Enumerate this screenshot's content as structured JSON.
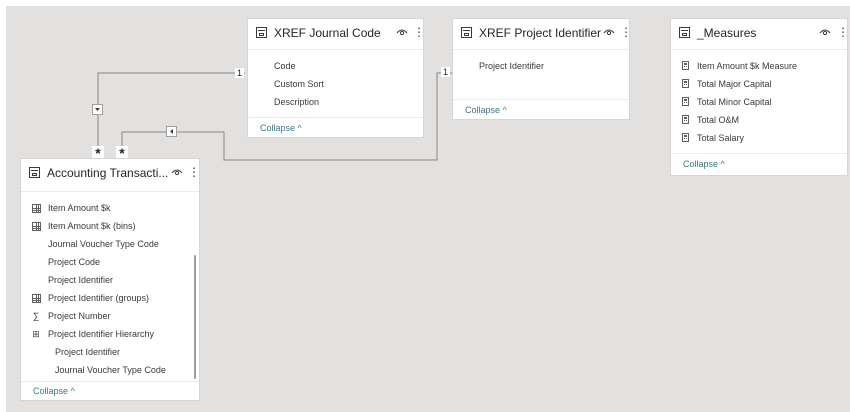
{
  "relationships": {
    "journal_one": "1",
    "project_one": "1",
    "many_left": "*",
    "many_right": "*"
  },
  "xref_journal": {
    "title": "XREF Journal Code",
    "fields": [
      "Code",
      "Custom Sort",
      "Description"
    ],
    "collapse": "Collapse ^"
  },
  "xref_project": {
    "title": "XREF Project Identifier",
    "fields": [
      "Project Identifier"
    ],
    "collapse": "Collapse ^"
  },
  "measures": {
    "title": "_Measures",
    "fields": [
      "Item Amount $k Measure",
      "Total Major Capital",
      "Total Minor Capital",
      "Total O&M",
      "Total Salary"
    ],
    "collapse": "Collapse ^"
  },
  "accounting": {
    "title": "Accounting Transacti...",
    "fields": [
      {
        "label": "Item Amount $k",
        "icon": "measure-table-icon"
      },
      {
        "label": "Item Amount $k (bins)",
        "icon": "bins-icon"
      },
      {
        "label": "Journal Voucher Type Code",
        "icon": ""
      },
      {
        "label": "Project Code",
        "icon": ""
      },
      {
        "label": "Project Identifier",
        "icon": ""
      },
      {
        "label": "Project Identifier (groups)",
        "icon": "bins-icon"
      },
      {
        "label": "Project Number",
        "icon": "sigma-icon"
      },
      {
        "label": "Project Identifier Hierarchy",
        "icon": "hierarchy-icon"
      },
      {
        "label": "Project Identifier",
        "icon": ""
      },
      {
        "label": "Journal Voucher Type Code",
        "icon": ""
      }
    ],
    "collapse": "Collapse ^"
  },
  "colors": {
    "canvas": "#e2e1e0",
    "card": "#ffffff",
    "text": "#3b3a39",
    "link": "#3b7a84",
    "line": "#8a8886"
  },
  "glyphs": {
    "more": "⋮",
    "sigma": "∑",
    "hierarchy": "⊞"
  }
}
